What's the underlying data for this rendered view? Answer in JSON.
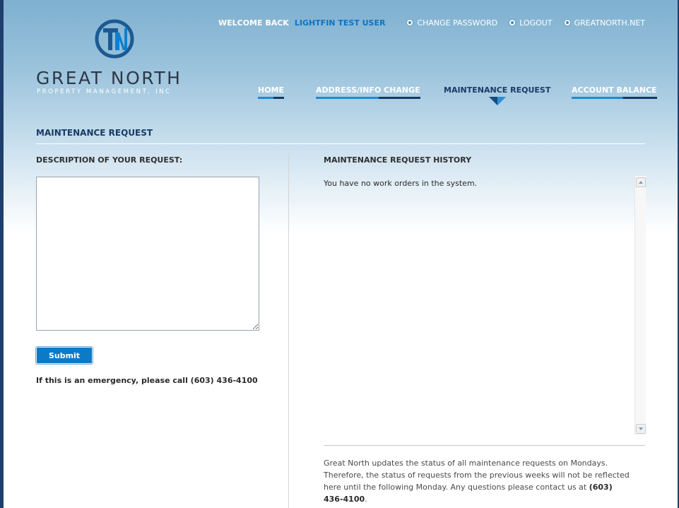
{
  "brand": {
    "name": "GREAT NORTH",
    "subtitle": "PROPERTY MANAGEMENT, INC"
  },
  "topbar": {
    "welcome": "WELCOME BACK",
    "username": "LIGHTFIN TEST USER",
    "links": [
      {
        "label": "CHANGE PASSWORD",
        "icon": "bullet-circle-icon"
      },
      {
        "label": "LOGOUT",
        "icon": "bullet-circle-icon"
      },
      {
        "label": "GREATNORTH.NET",
        "icon": "bullet-circle-icon"
      }
    ]
  },
  "nav": {
    "items": [
      {
        "label": "HOME",
        "active": false
      },
      {
        "label": "ADDRESS/INFO CHANGE",
        "active": false
      },
      {
        "label": "MAINTENANCE REQUEST",
        "active": true
      },
      {
        "label": "ACCOUNT BALANCE",
        "active": false
      }
    ]
  },
  "page": {
    "title": "MAINTENANCE REQUEST"
  },
  "request_form": {
    "description_label": "DESCRIPTION OF YOUR REQUEST:",
    "description_value": "",
    "submit_label": "Submit",
    "emergency_text": "If this is an emergency, please call (603) 436-4100"
  },
  "history": {
    "title": "MAINTENANCE REQUEST HISTORY",
    "empty_message": "You have no work orders in the system.",
    "note_text": "Great North updates the status of all maintenance requests on Mondays. Therefore, the status of requests from the previous weeks will not be reflected here until the following Monday. Any questions please contact us at ",
    "note_phone": "(603) 436-4100",
    "note_end": "."
  },
  "colors": {
    "accent_blue": "#0e73c2",
    "navy": "#1a3a66",
    "button_blue": "#0d7ac6"
  }
}
